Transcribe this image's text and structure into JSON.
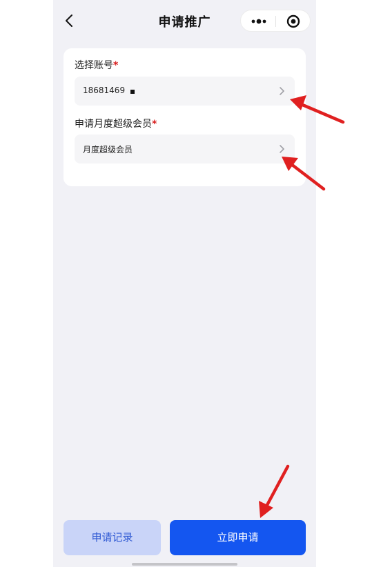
{
  "nav": {
    "title": "申请推广",
    "back_icon": "chevron-left-icon",
    "more_icon": "more-dots-icon",
    "close_icon": "target-circle-icon"
  },
  "form": {
    "account": {
      "label": "选择账号",
      "required_mark": "*",
      "value": "18681469"
    },
    "membership": {
      "label": "申请月度超级会员",
      "required_mark": "*",
      "value": "月度超级会员"
    }
  },
  "actions": {
    "records_label": "申请记录",
    "apply_label": "立即申请"
  },
  "colors": {
    "primary": "#1456f0",
    "secondary_bg": "#c9d4f8",
    "required": "#d81e1e",
    "annotation_arrow": "#e02020"
  }
}
